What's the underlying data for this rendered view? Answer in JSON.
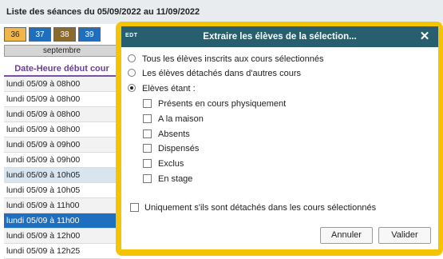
{
  "list": {
    "title": "Liste des séances du 05/09/2022 au 11/09/2022",
    "weeks": [
      {
        "label": "36",
        "bg": "#f0b64a",
        "fg": "#222222"
      },
      {
        "label": "37",
        "bg": "#1f6fc0",
        "fg": "#ffffff"
      },
      {
        "label": "38",
        "bg": "#8b6a2e",
        "fg": "#ffffff"
      },
      {
        "label": "39",
        "bg": "#1f6fc0",
        "fg": "#ffffff"
      }
    ],
    "month": "septembre",
    "column_header": "Date-Heure début cour",
    "rows": [
      "lundi 05/09 à 08h00",
      "lundi 05/09 à 08h00",
      "lundi 05/09 à 08h00",
      "lundi 05/09 à 08h00",
      "lundi 05/09 à 09h00",
      "lundi 05/09 à 09h00",
      "lundi 05/09 à 10h05",
      "lundi 05/09 à 10h05",
      "lundi 05/09 à 11h00",
      "lundi 05/09 à 11h00",
      "lundi 05/09 à 12h00",
      "lundi 05/09 à 12h25"
    ]
  },
  "dialog": {
    "logo": "EDT",
    "title": "Extraire les élèves de la sélection...",
    "close": "✕",
    "radios": [
      {
        "label": "Tous les élèves inscrits aux cours sélectionnés",
        "checked": false
      },
      {
        "label": "Les élèves détachés dans d'autres cours",
        "checked": false
      },
      {
        "label": "Elèves étant :",
        "checked": true
      }
    ],
    "checks": [
      "Présents en cours physiquement",
      "A la maison",
      "Absents",
      "Dispensés",
      "Exclus",
      "En stage"
    ],
    "only_detached": "Uniquement s'ils sont détachés dans les cours sélectionnés",
    "cancel": "Annuler",
    "validate": "Valider"
  },
  "colors": {
    "header": "#275f6e",
    "frame": "#f5c400",
    "selected_row": "#1f6fc0"
  }
}
